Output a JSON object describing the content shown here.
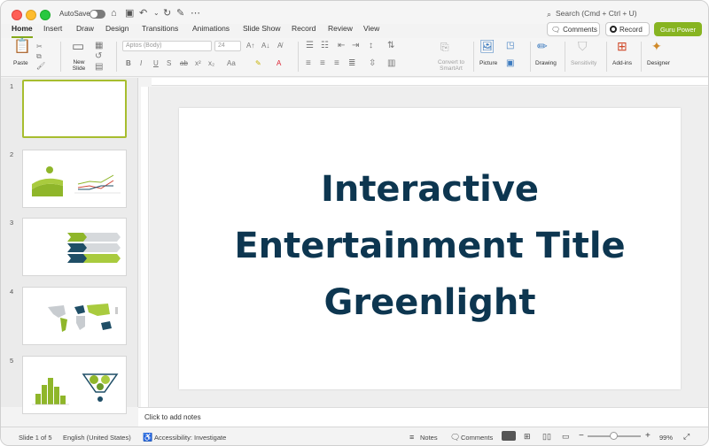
{
  "titlebar": {
    "autosave_label": "AutoSave",
    "search_placeholder": "Search (Cmd + Ctrl + U)"
  },
  "tabs": [
    "Home",
    "Insert",
    "Draw",
    "Design",
    "Transitions",
    "Animations",
    "Slide Show",
    "Record",
    "Review",
    "View"
  ],
  "active_tab": "Home",
  "actions": {
    "comments": "Comments",
    "record": "Record",
    "guru": "Guru Power"
  },
  "ribbon": {
    "paste": "Paste",
    "new_slide": "New Slide",
    "font_name": "Aptos (Body)",
    "font_size": "24",
    "convert_smartart": "Convert to SmartArt",
    "picture": "Picture",
    "drawing": "Drawing",
    "sensitivity": "Sensitivity",
    "addins": "Add-ins",
    "designer": "Designer"
  },
  "slides": [
    {
      "number": "1"
    },
    {
      "number": "2"
    },
    {
      "number": "3"
    },
    {
      "number": "4"
    },
    {
      "number": "5"
    }
  ],
  "slide": {
    "title_line1": "Interactive",
    "title_line2": "Entertainment Title",
    "title_line3": "Greenlight"
  },
  "notes_placeholder": "Click to add notes",
  "status": {
    "slide_counter": "Slide 1 of 5",
    "language": "English (United States)",
    "accessibility": "Accessibility: Investigate",
    "notes": "Notes",
    "comments": "Comments",
    "zoom": "99%"
  },
  "colors": {
    "accent": "#86a91a",
    "title_text": "#0d3650",
    "guru_button": "#87b421"
  }
}
